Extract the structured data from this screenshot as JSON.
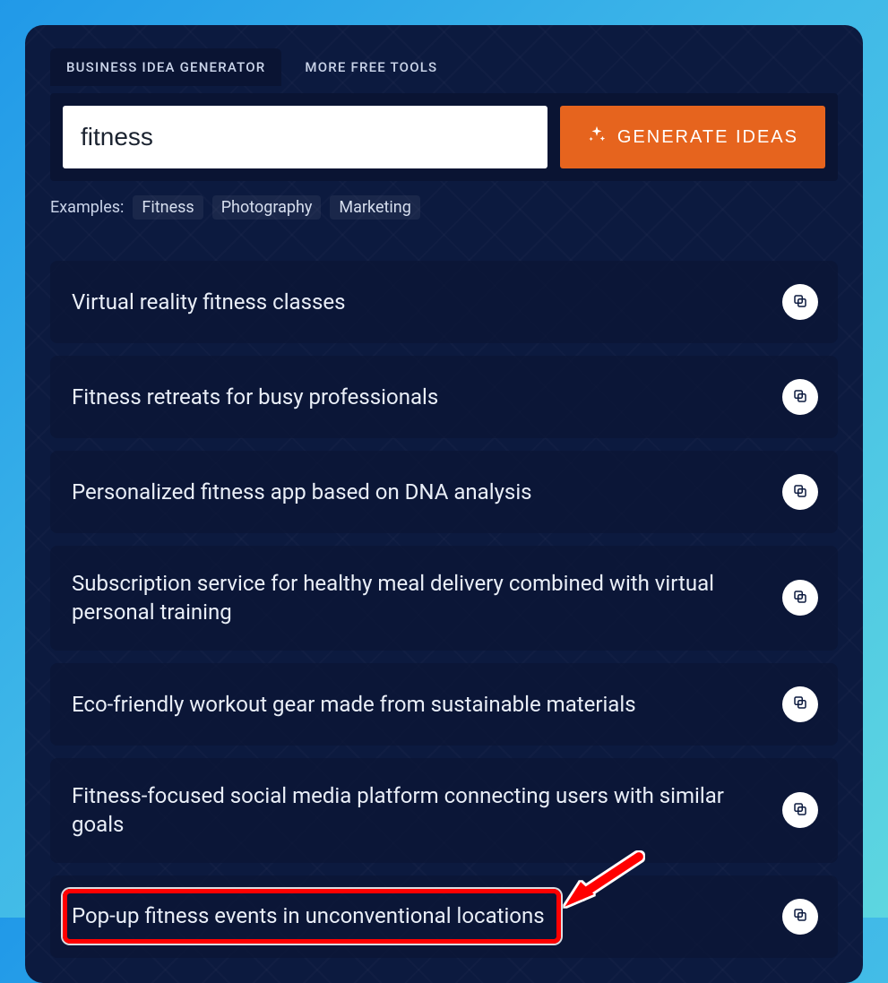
{
  "tabs": [
    {
      "label": "BUSINESS IDEA GENERATOR",
      "active": true
    },
    {
      "label": "MORE FREE TOOLS",
      "active": false
    }
  ],
  "search": {
    "value": "fitness",
    "placeholder": ""
  },
  "generate_label": "GENERATE IDEAS",
  "examples_label": "Examples:",
  "examples": [
    "Fitness",
    "Photography",
    "Marketing"
  ],
  "ideas": [
    "Virtual reality fitness classes",
    "Fitness retreats for busy professionals",
    "Personalized fitness app based on DNA analysis",
    "Subscription service for healthy meal delivery combined with virtual personal training",
    "Eco-friendly workout gear made from sustainable materials",
    "Fitness-focused social media platform connecting users with similar goals",
    "Pop-up fitness events in unconventional locations"
  ],
  "highlight_idea_index": 6,
  "colors": {
    "accent": "#e6641e",
    "panel": "#0c1a3f",
    "highlight": "#ff0000"
  }
}
